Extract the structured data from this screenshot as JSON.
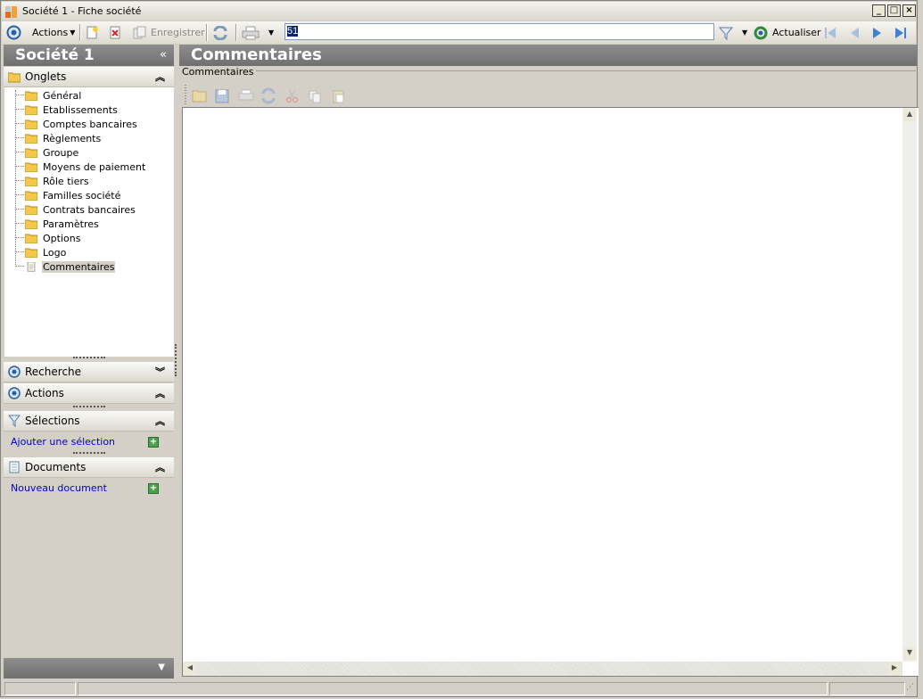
{
  "window": {
    "title": "Société 1 -  Fiche société",
    "controls": [
      "minimize",
      "maximize",
      "close"
    ]
  },
  "toolbar": {
    "actions_label": "Actions",
    "save_label": "Enregistrer",
    "search_value": "51",
    "refresh_label": "Actualiser"
  },
  "left": {
    "title": "Société 1",
    "collapse_glyph": "«",
    "onglets": {
      "label": "Onglets",
      "items": [
        {
          "label": "Général"
        },
        {
          "label": "Etablissements"
        },
        {
          "label": "Comptes bancaires"
        },
        {
          "label": "Règlements"
        },
        {
          "label": "Groupe"
        },
        {
          "label": "Moyens de paiement"
        },
        {
          "label": "Rôle tiers"
        },
        {
          "label": "Familles société"
        },
        {
          "label": "Contrats bancaires"
        },
        {
          "label": "Paramètres"
        },
        {
          "label": "Options"
        },
        {
          "label": "Logo"
        },
        {
          "label": "Commentaires",
          "selected": true
        }
      ]
    },
    "recherche": {
      "label": "Recherche"
    },
    "actions": {
      "label": "Actions"
    },
    "selections": {
      "label": "Sélections",
      "link": "Ajouter une sélection"
    },
    "documents": {
      "label": "Documents",
      "link": "Nouveau document"
    }
  },
  "main": {
    "title": "Commentaires",
    "group_label": "Commentaires"
  },
  "colors": {
    "header_dark": "#7a7a7a",
    "link": "#0000cc",
    "selection": "#0a246a",
    "folder": "#f2c94c"
  }
}
